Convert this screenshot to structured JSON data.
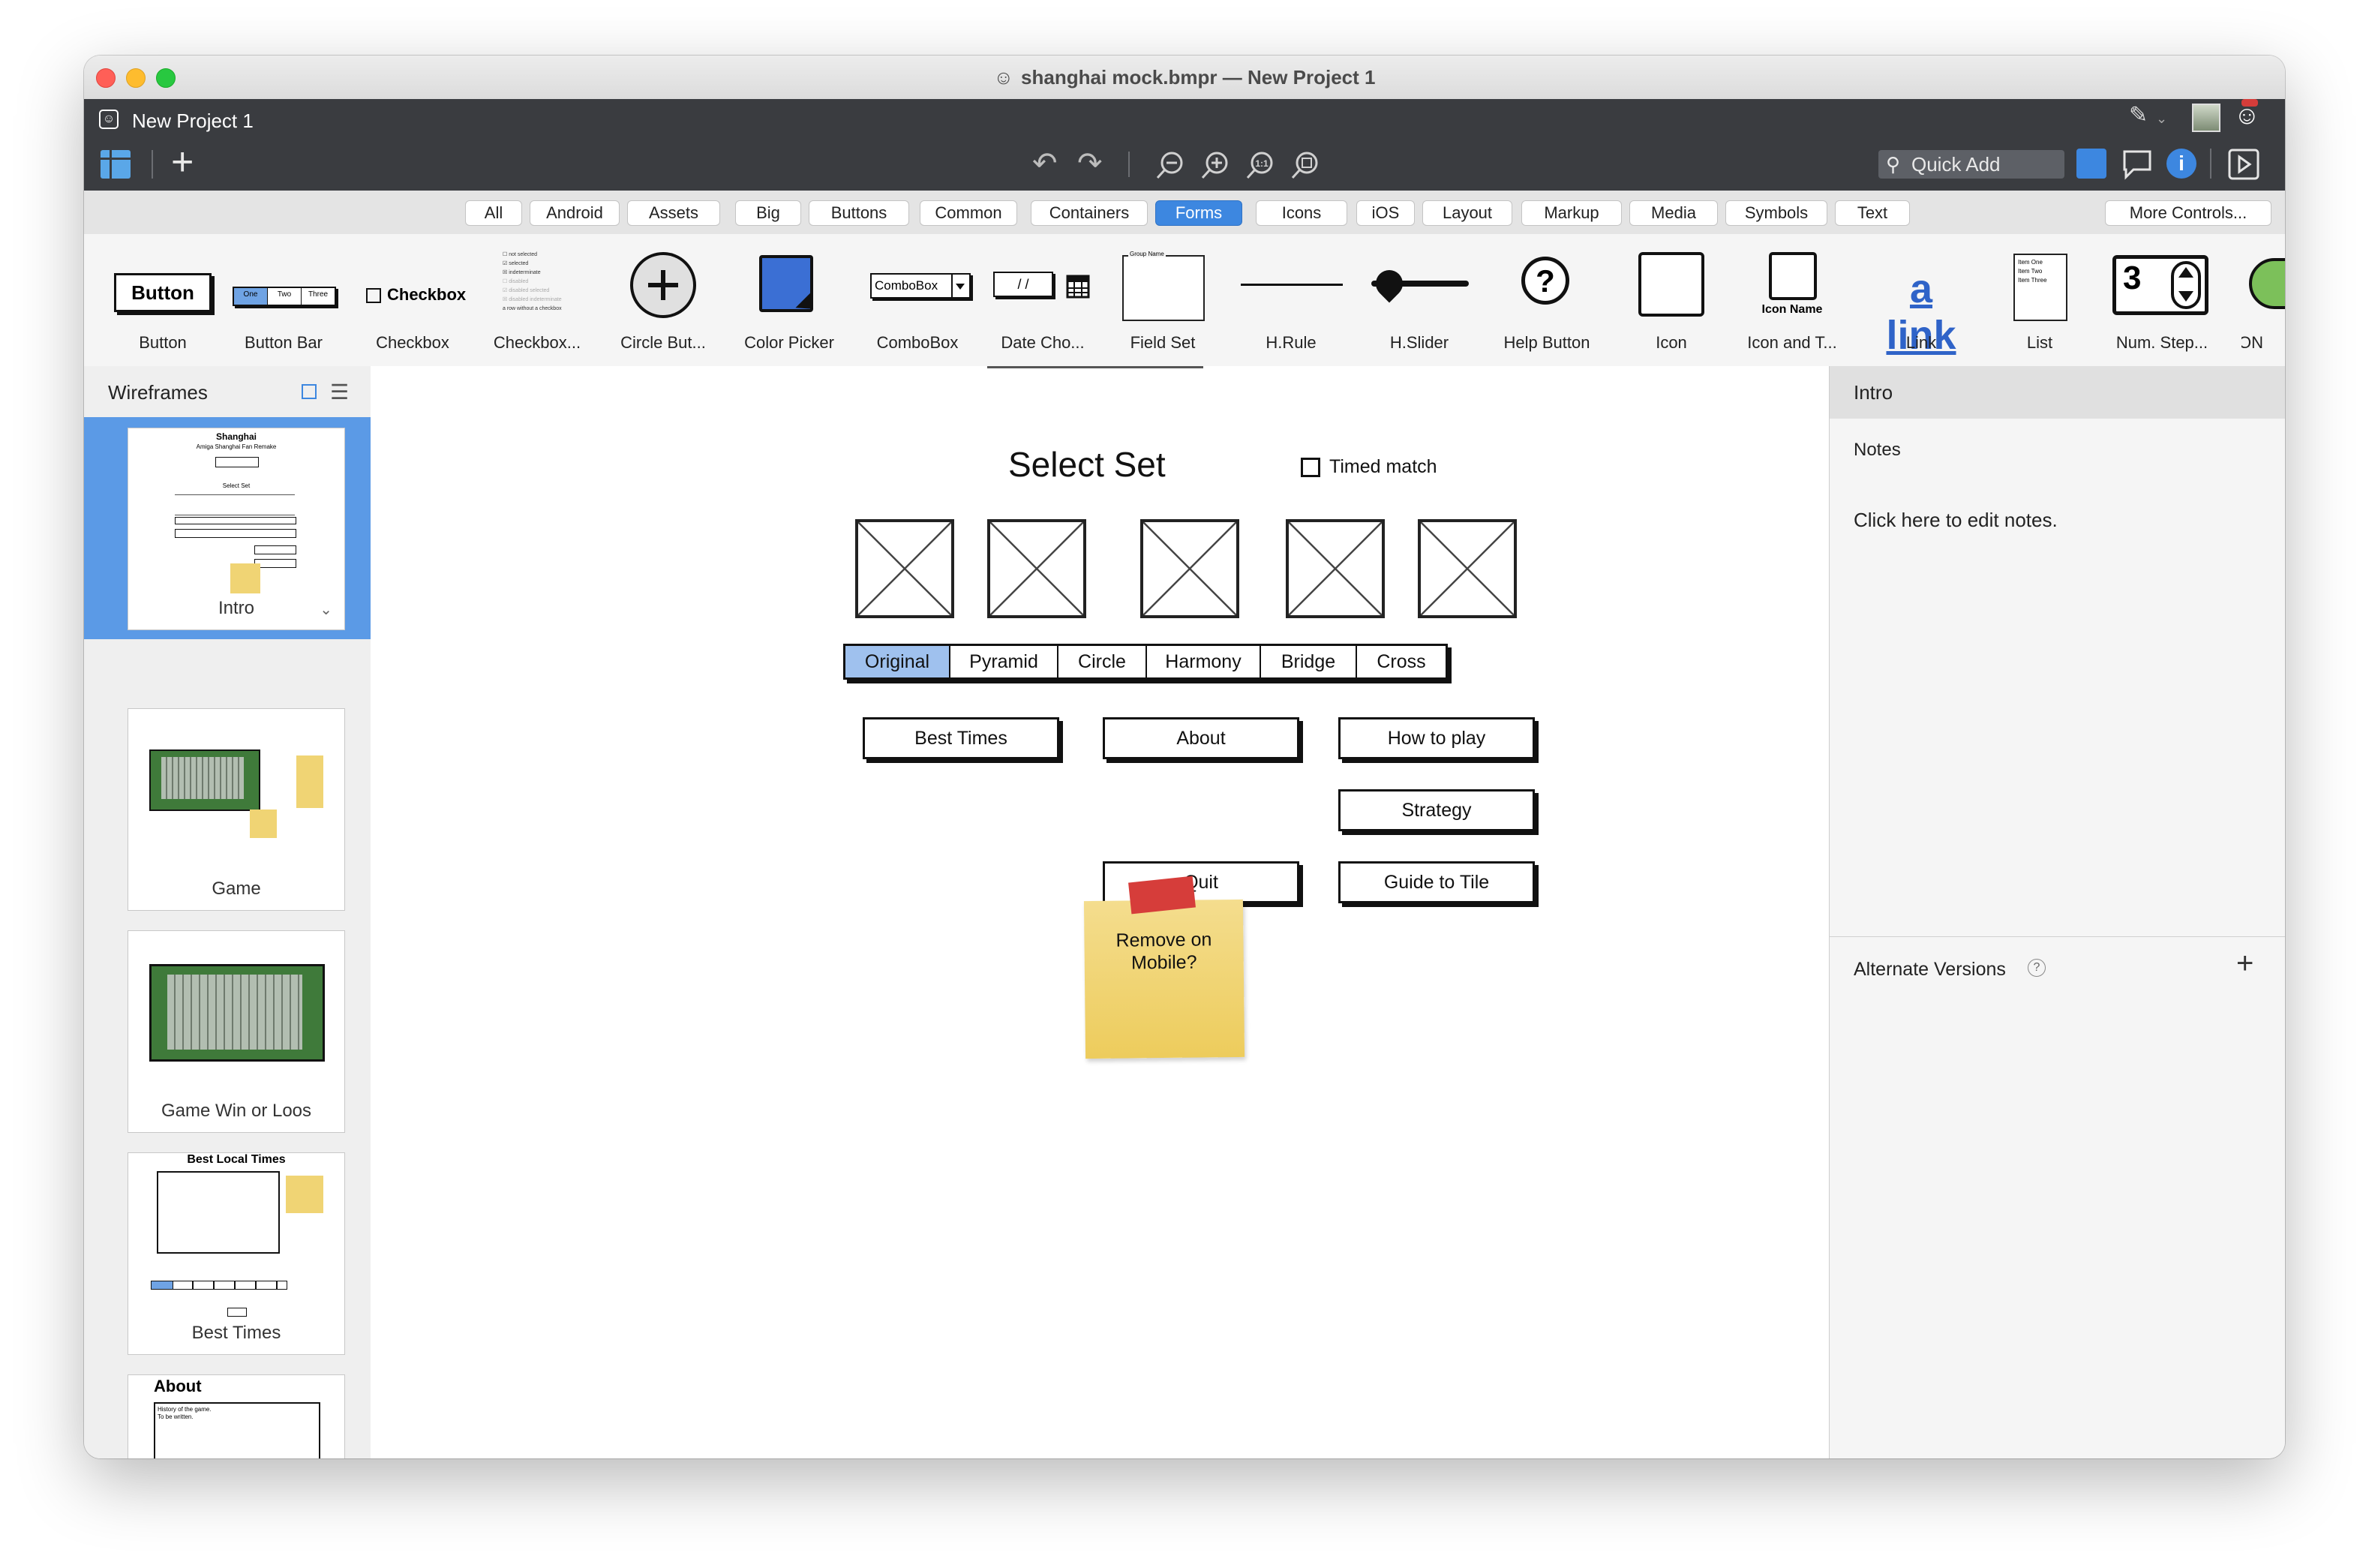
{
  "window": {
    "title": "shanghai mock.bmpr — New Project 1"
  },
  "toolbar": {
    "project_name": "New Project 1",
    "quick_add_placeholder": "Quick Add"
  },
  "categories": [
    {
      "label": "All"
    },
    {
      "label": "Android"
    },
    {
      "label": "Assets"
    },
    {
      "label": "Big"
    },
    {
      "label": "Buttons"
    },
    {
      "label": "Common"
    },
    {
      "label": "Containers"
    },
    {
      "label": "Forms",
      "active": true
    },
    {
      "label": "Icons"
    },
    {
      "label": "iOS"
    },
    {
      "label": "Layout"
    },
    {
      "label": "Markup"
    },
    {
      "label": "Media"
    },
    {
      "label": "Symbols"
    },
    {
      "label": "Text"
    }
  ],
  "more_controls": "More Controls...",
  "library": {
    "items": [
      {
        "label": "Button",
        "icon": "button"
      },
      {
        "label": "Button Bar",
        "icon": "button-bar"
      },
      {
        "label": "Checkbox",
        "icon": "checkbox"
      },
      {
        "label": "Checkbox...",
        "icon": "checkbox-group"
      },
      {
        "label": "Circle But...",
        "icon": "circle-button"
      },
      {
        "label": "Color Picker",
        "icon": "color-picker"
      },
      {
        "label": "ComboBox",
        "icon": "combobox"
      },
      {
        "label": "Date Cho...",
        "icon": "date-chooser"
      },
      {
        "label": "Field Set",
        "icon": "field-set"
      },
      {
        "label": "H.Rule",
        "icon": "h-rule"
      },
      {
        "label": "H.Slider",
        "icon": "h-slider"
      },
      {
        "label": "Help Button",
        "icon": "help-button"
      },
      {
        "label": "Icon",
        "icon": "icon"
      },
      {
        "label": "Icon and T...",
        "icon": "icon-and-text"
      },
      {
        "label": "Link",
        "icon": "link"
      },
      {
        "label": "List",
        "icon": "list"
      },
      {
        "label": "Num. Step...",
        "icon": "numeric-stepper"
      },
      {
        "label": "ON",
        "icon": "switch"
      }
    ],
    "previews": {
      "button": "Button",
      "button_bar": [
        "One",
        "Two",
        "Three"
      ],
      "checkbox": "Checkbox",
      "checkbox_group": [
        "not selected",
        "selected",
        "indeterminate",
        "disabled",
        "disabled selected",
        "disabled indeterminate",
        "a row without a checkbox"
      ],
      "combobox": "ComboBox",
      "date_value": "/ /",
      "field_set": "Group Name",
      "help": "?",
      "icon_and_text": "Icon Name",
      "link": "a link",
      "list": [
        "Item One",
        "Item Two",
        "Item Three"
      ],
      "stepper_value": "3"
    }
  },
  "sidebar": {
    "title": "Wireframes",
    "wireframes": [
      {
        "label": "Intro",
        "selected": true
      },
      {
        "label": "Game"
      },
      {
        "label": "Game Win or Loos"
      },
      {
        "label": "Best Times"
      },
      {
        "label": "About"
      }
    ],
    "thumb_texts": {
      "intro_title": "Shanghai",
      "intro_subtitle": "Amiga Shanghai Fan Remake",
      "intro_select": "Select Set",
      "best_local_times": "Best Local Times",
      "about": "About",
      "about_body": "History of the game.\nTo be written."
    }
  },
  "canvas": {
    "heading": "Select Set",
    "timed_match": "Timed match",
    "sets": [
      "Original",
      "Pyramid",
      "Circle",
      "Harmony",
      "Bridge",
      "Cross"
    ],
    "selected_set": "Original",
    "buttons": {
      "best_times": "Best Times",
      "about": "About",
      "how_to_play": "How to play",
      "strategy": "Strategy",
      "quit": "Quit",
      "guide_to_tile": "Guide to Tile"
    },
    "sticky_note": "Remove  on\nMobile?"
  },
  "right_panel": {
    "title": "Intro",
    "notes_label": "Notes",
    "notes_placeholder": "Click here to edit notes.",
    "alternate_versions": "Alternate Versions",
    "help_glyph": "?"
  },
  "colors": {
    "accent": "#3d87e0",
    "toolbar": "#3a3c40",
    "sticky": "#f0d474",
    "tape": "#d63d3a",
    "selected_set": "#9fc1ee"
  }
}
